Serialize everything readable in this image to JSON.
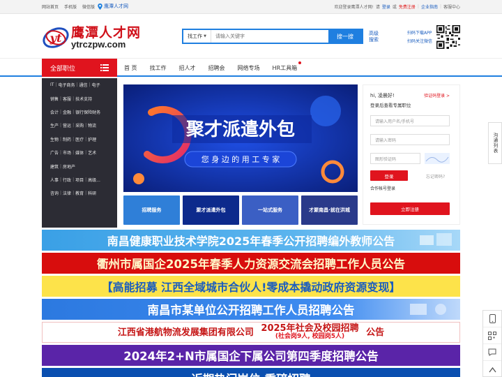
{
  "topbar": {
    "links": [
      "网站首页",
      "手机版",
      "微信版"
    ],
    "location": "鹰潭人才网",
    "welcome": "欢迎登录鹰潭人才网!",
    "please": "请",
    "login": "登录",
    "or": "或",
    "register": "免费注册",
    "enterprise": "企业指南",
    "service": "客服中心"
  },
  "header": {
    "logo_cn": "鹰潭人才网",
    "logo_en": "ytrczpw.com",
    "logo_mark": "yt",
    "search_type": "找工作",
    "search_placeholder": "请输入关键字",
    "search_button": "搜一搜",
    "advanced_search": "高级搜索",
    "app_download": "扫码下载APP",
    "wechat_follow": "扫码关注微信"
  },
  "nav": {
    "all_jobs": "全部职位",
    "items": [
      "首 页",
      "找工作",
      "招人才",
      "招聘会",
      "网络专场",
      "HR工具箱"
    ]
  },
  "categories": [
    [
      "IT",
      "电子商务",
      "通信",
      "电子"
    ],
    [
      "销售",
      "客服",
      "技术支持"
    ],
    [
      "会计",
      "金融",
      "银行保险财务"
    ],
    [
      "生产",
      "营运",
      "采购",
      "物流"
    ],
    [
      "生物",
      "制药",
      "医疗",
      "护理"
    ],
    [
      "广告",
      "市场",
      "媒体",
      "艺术"
    ],
    [
      "建筑",
      "房地产"
    ],
    [
      "人事",
      "行政",
      "项目",
      "高级..."
    ],
    [
      "咨询",
      "法律",
      "教育",
      "科研"
    ],
    []
  ],
  "banner": {
    "headline": "聚才派遣外包",
    "tagline": "您 身 边 的 用 工 专 家"
  },
  "thumbs": [
    {
      "label": "招聘服务",
      "color": "#2f7fd8"
    },
    {
      "label": "聚才派遣外包",
      "color": "#0d2a8c"
    },
    {
      "label": "一站式服务",
      "color": "#3b5fc4"
    },
    {
      "label": "才聚南昌·就在洪城",
      "color": "#2a3a8a"
    }
  ],
  "login": {
    "greeting": "hi, 凌晨好!",
    "code_login": "验证码登录 >",
    "subtitle": "登录后查看专属职位",
    "username_placeholder": "请输入用户名/手机号",
    "password_placeholder": "请输入密码",
    "captcha_placeholder": "图形验证码",
    "login_button": "登录",
    "forgot": "忘记密码?",
    "partner": "合作帐号登录",
    "register_button": "立即注册"
  },
  "float_tab": "沟通列表",
  "ads": [
    "南昌健康职业技术学院2025年春季公开招聘编外教师公告",
    "衢州市属国企2025年春季人力资源交流会招聘工作人员公告",
    "【高能招募 江西全域城市合伙人!零成本撬动政府资源变现】",
    "南昌市某单位公开招聘工作人员招聘公告",
    {
      "main": "江西省港航物流发展集团有限公司",
      "top": "2025年社会及校园招聘",
      "bottom": "(社会岗9人, 校园岗5人)",
      "suffix": "公告"
    },
    "2024年2+N市属国企下属公司第四季度招聘公告",
    "近期热门岗位·重磅招聘"
  ]
}
